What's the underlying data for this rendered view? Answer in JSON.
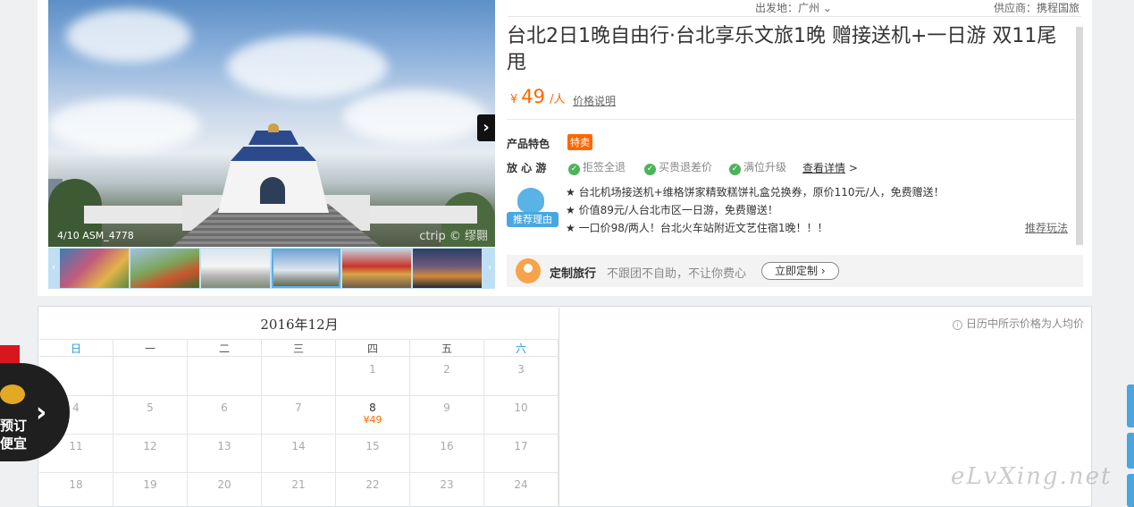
{
  "header": {
    "departure_label": "出发地：广州",
    "supplier_label": "供应商：携程国旅"
  },
  "gallery": {
    "caption": "4/10 ASM_4778",
    "watermark": "ctrip © 缪翾"
  },
  "product": {
    "title": "台北2日1晚自由行·台北享乐文旅1晚 赠接送机+一日游 双11尾甩",
    "price_currency": "¥",
    "price_value": "49",
    "price_unit": "/人",
    "price_note": "价格说明"
  },
  "features": {
    "label": "产品特色",
    "badge": "特卖",
    "assurance_label": "放 心 游",
    "guarantees": [
      "拒签全退",
      "买贵退差价",
      "满位升级"
    ],
    "more_link": "查看详情",
    "more_arrow": ">"
  },
  "recommend": {
    "icon_label": "推荐理由",
    "lines": [
      "★ 台北机场接送机+维格饼家精致糕饼礼盒兑换券，原价110元/人，免费赠送！",
      "★ 价值89元/人台北市区一日游，免费赠送！",
      "★ 一口价98/两人！台北火车站附近文艺住宿1晚！！！"
    ],
    "play_link": "推荐玩法"
  },
  "custom": {
    "title": "定制旅行",
    "subtitle": "不跟团不自助，不让你费心",
    "button": "立即定制"
  },
  "calendar": {
    "month": "2016年12月",
    "note": "日历中所示价格为人均价",
    "weekdays": [
      "日",
      "一",
      "二",
      "三",
      "四",
      "五",
      "六"
    ],
    "rows": [
      [
        "",
        "",
        "",
        "",
        "1",
        "2",
        "3"
      ],
      [
        "4",
        "5",
        "6",
        "7",
        "8",
        "9",
        "10"
      ],
      [
        "11",
        "12",
        "13",
        "14",
        "15",
        "16",
        "17"
      ],
      [
        "18",
        "19",
        "20",
        "21",
        "22",
        "23",
        "24"
      ]
    ],
    "available_day": "8",
    "available_price": "¥49"
  },
  "promo": {
    "text_line1": "预订",
    "text_line2": "便宜"
  },
  "site_watermark": "eLvXing.net"
}
